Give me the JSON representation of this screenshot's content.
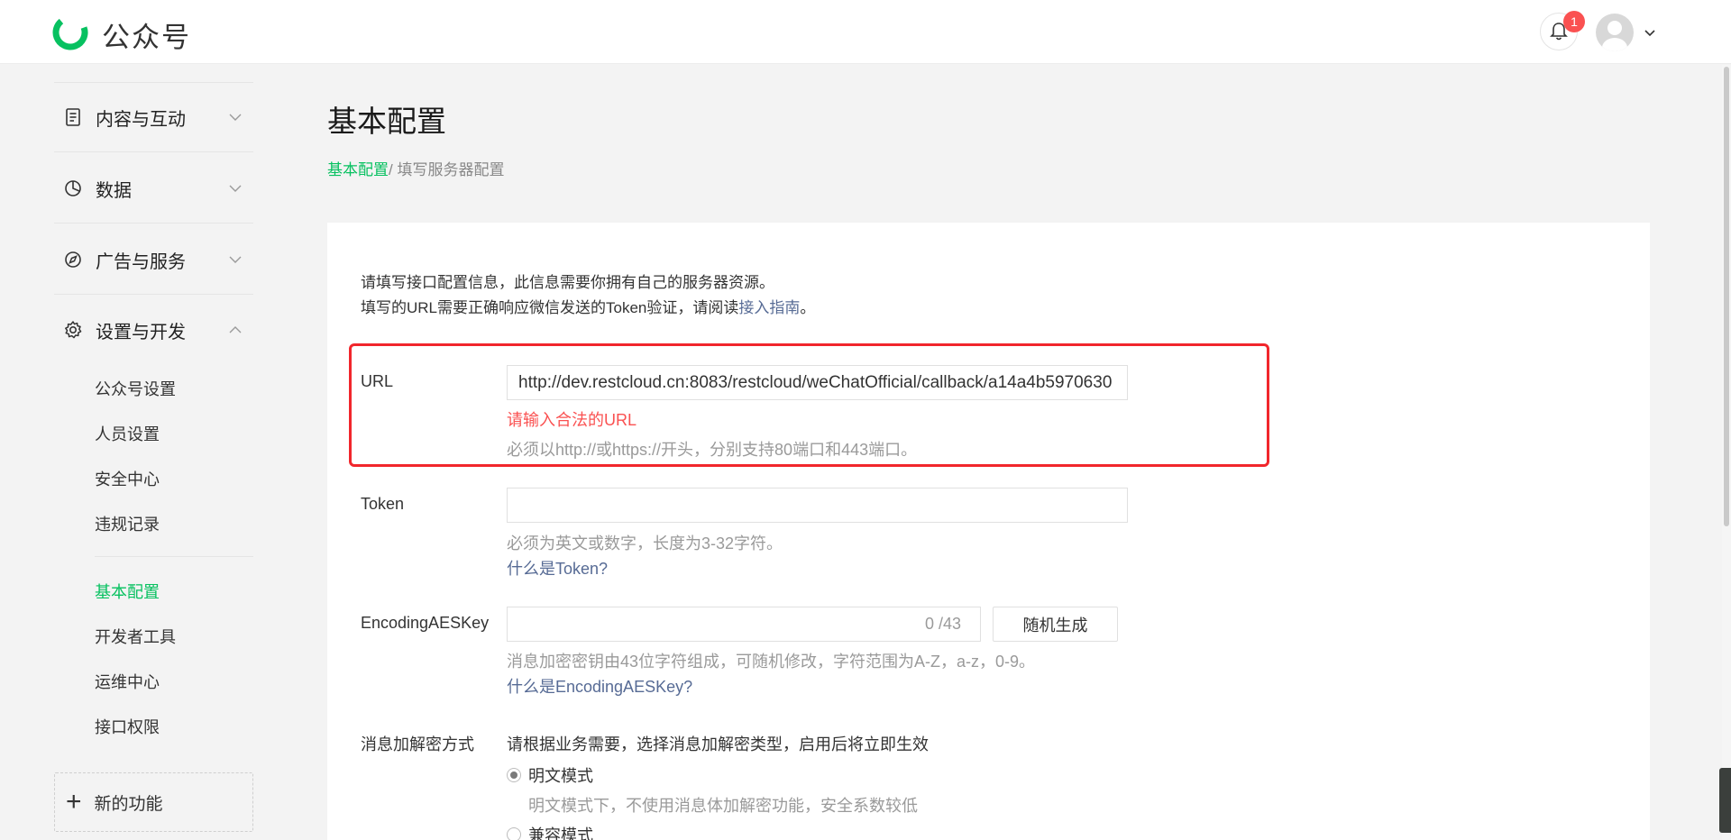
{
  "app": {
    "brand": "公众号",
    "notification_count": "1"
  },
  "sidebar": {
    "groups": [
      {
        "label": "内容与互动",
        "icon": "document-icon"
      },
      {
        "label": "数据",
        "icon": "pie-chart-icon"
      },
      {
        "label": "广告与服务",
        "icon": "compass-icon"
      },
      {
        "label": "设置与开发",
        "icon": "gear-icon"
      }
    ],
    "sub_items": [
      "公众号设置",
      "人员设置",
      "安全中心",
      "违规记录",
      "基本配置",
      "开发者工具",
      "运维中心",
      "接口权限"
    ],
    "active_item": "基本配置",
    "new_feature": "新的功能"
  },
  "main": {
    "title": "基本配置",
    "breadcrumb": {
      "link": "基本配置",
      "separator": "/ ",
      "current": "填写服务器配置"
    },
    "intro_line1": "请填写接口配置信息，此信息需要你拥有自己的服务器资源。",
    "intro_line2_prefix": "填写的URL需要正确响应微信发送的Token验证，请阅读",
    "intro_link": "接入指南",
    "intro_line2_suffix": "。",
    "url": {
      "label": "URL",
      "value": "http://dev.restcloud.cn:8083/restcloud/weChatOfficial/callback/a14a4b5970630",
      "error": "请输入合法的URL",
      "hint": "必须以http://或https://开头，分别支持80端口和443端口。"
    },
    "token": {
      "label": "Token",
      "value": "",
      "hint": "必须为英文或数字，长度为3-32字符。",
      "help_link": "什么是Token?"
    },
    "aes": {
      "label": "EncodingAESKey",
      "value": "",
      "counter": "0 /43",
      "generate_button": "随机生成",
      "hint": "消息加密密钥由43位字符组成，可随机修改，字符范围为A-Z，a-z，0-9。",
      "help_link": "什么是EncodingAESKey?"
    },
    "encryption": {
      "label": "消息加解密方式",
      "description": "请根据业务需要，选择消息加解密类型，启用后将立即生效",
      "options": [
        {
          "label": "明文模式",
          "desc": "明文模式下，不使用消息体加解密功能，安全系数较低",
          "checked": true
        },
        {
          "label": "兼容模式",
          "checked": false
        }
      ]
    }
  },
  "colors": {
    "accent": "#07c160",
    "error": "#fa5151",
    "link": "#576b95",
    "highlight_box": "#f1262c"
  }
}
